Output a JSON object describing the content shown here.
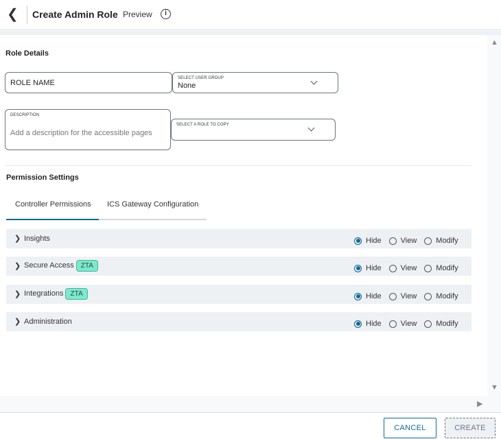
{
  "header": {
    "title": "Create Admin Role",
    "preview": "Preview",
    "back_icon": "chevron-left",
    "info_icon": "i"
  },
  "role_details": {
    "heading": "Role Details",
    "role_name": {
      "placeholder": "ROLE NAME",
      "value": ""
    },
    "user_group": {
      "label": "SELECT USER GROUP",
      "value": "None"
    },
    "description": {
      "label": "DESCRIPTION",
      "placeholder": "Add a description for the accessible pages",
      "value": ""
    },
    "copy_role": {
      "label": "SELECT A ROLE TO COPY",
      "value": ""
    }
  },
  "permissions": {
    "heading": "Permission Settings",
    "tabs": [
      {
        "label": "Controller Permissions",
        "active": true
      },
      {
        "label": "ICS Gateway Configuration",
        "active": false
      }
    ],
    "options": [
      "Hide",
      "View",
      "Modify"
    ],
    "rows": [
      {
        "label": "Insights",
        "badge": "",
        "selected": "Hide"
      },
      {
        "label": "Secure Access",
        "badge": "ZTA",
        "selected": "Hide"
      },
      {
        "label": "Integrations",
        "badge": "ZTA",
        "selected": "Hide"
      },
      {
        "label": "Administration",
        "badge": "",
        "selected": "Hide"
      }
    ]
  },
  "footer": {
    "cancel": "CANCEL",
    "create": "CREATE"
  },
  "colors": {
    "accent": "#0b6a9a",
    "badge": "#7fe8cc",
    "row_bg": "#eef1f4"
  }
}
